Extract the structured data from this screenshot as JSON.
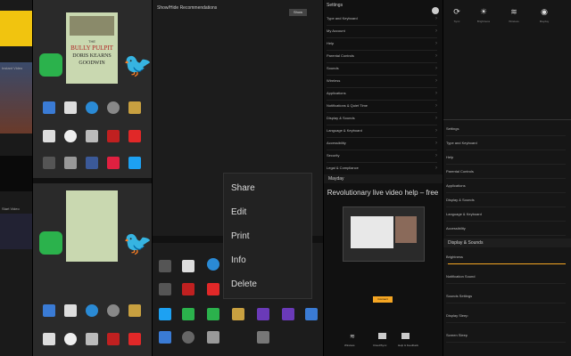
{
  "carousel": {
    "book_series": "THE",
    "book_title": "BULLY PULPIT",
    "book_author_1": "DORIS KEARNS",
    "book_author_2": "GOODWIN"
  },
  "recommendations": {
    "title": "Show/Hide Recommendations",
    "button": "Show"
  },
  "settings": {
    "title": "Settings",
    "items": [
      "Type and Keyboard",
      "My Account",
      "Help",
      "Parental Controls",
      "Sounds",
      "Wireless",
      "Applications",
      "Notifications & Quiet Time",
      "Display & Sounds",
      "Language & Keyboard",
      "Accessibility",
      "Security",
      "Legal & Compliance"
    ]
  },
  "mayday": {
    "header": "Mayday",
    "headline": "Revolutionary live video help – free",
    "cta": "Connect",
    "bottom_labels": [
      "Wireless",
      "Cloud/Sync",
      "Help & Feedback"
    ]
  },
  "context_menu": {
    "items": [
      "Share",
      "Edit",
      "Print",
      "Info",
      "Delete"
    ]
  },
  "quick_settings": {
    "labels": [
      "Sync",
      "Brightness",
      "Wireless",
      "Mayday"
    ],
    "lower_items": [
      "Settings",
      "Type and Keyboard",
      "Help",
      "Parental Controls",
      "Applications",
      "Display & Sounds",
      "Language & Keyboard",
      "Accessibility"
    ],
    "display_title": "Display & Sounds",
    "display_items": [
      "Brightness",
      "Notification Sound",
      "Sounds Settings",
      "Display Sleep",
      "Screen Sleep"
    ]
  },
  "left_strip": {
    "label1": "Instant Video",
    "label2": "Start Video"
  },
  "colors": {
    "accent": "#f5a623",
    "twitter": "#1da1f2",
    "feedly": "#2bb24c",
    "flipboard": "#e12828"
  }
}
